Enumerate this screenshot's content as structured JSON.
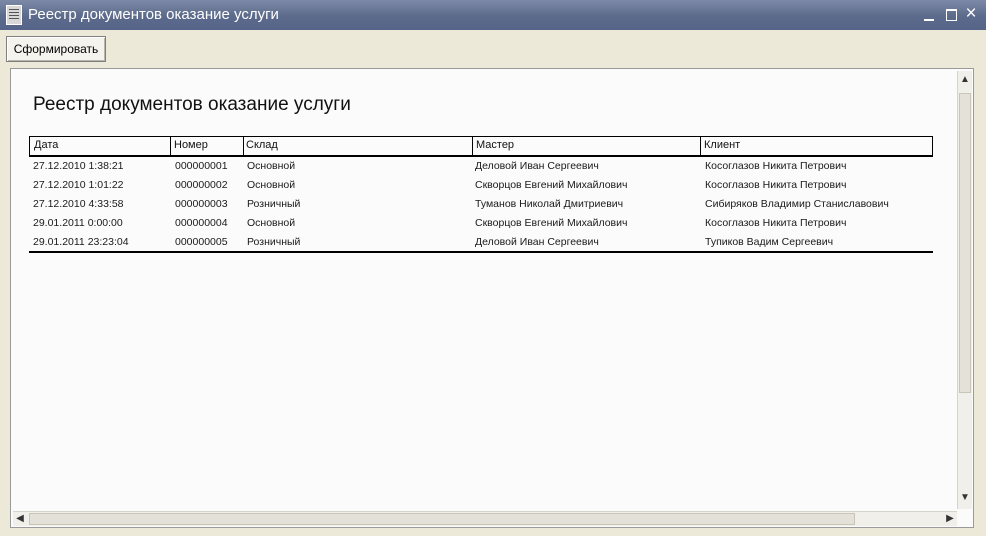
{
  "window": {
    "title": "Реестр документов оказание услуги",
    "controls": {
      "minimize": "",
      "maximize": "",
      "close": "×"
    }
  },
  "toolbar": {
    "generate_label": "Сформировать"
  },
  "report": {
    "title": "Реестр документов оказание услуги",
    "columns": [
      "Дата",
      "Номер",
      "Склад",
      "Мастер",
      "Клиент"
    ],
    "rows": [
      [
        "27.12.2010 1:38:21",
        "000000001",
        "Основной",
        "Деловой Иван Сергеевич",
        "Косоглазов Никита Петрович"
      ],
      [
        "27.12.2010 1:01:22",
        "000000002",
        "Основной",
        "Скворцов Евгений Михайлович",
        "Косоглазов Никита Петрович"
      ],
      [
        "27.12.2010 4:33:58",
        "000000003",
        "Розничный",
        "Туманов Николай Дмитриевич",
        "Сибиряков Владимир Станиславович"
      ],
      [
        "29.01.2011 0:00:00",
        "000000004",
        "Основной",
        "Скворцов Евгений Михайлович",
        "Косоглазов Никита Петрович"
      ],
      [
        "29.01.2011 23:23:04",
        "000000005",
        "Розничный",
        "Деловой Иван Сергеевич",
        "Тупиков Вадим Сергеевич"
      ]
    ]
  },
  "scrollbars": {
    "up": "▲",
    "down": "▼",
    "left": "◀",
    "right": "▶"
  }
}
